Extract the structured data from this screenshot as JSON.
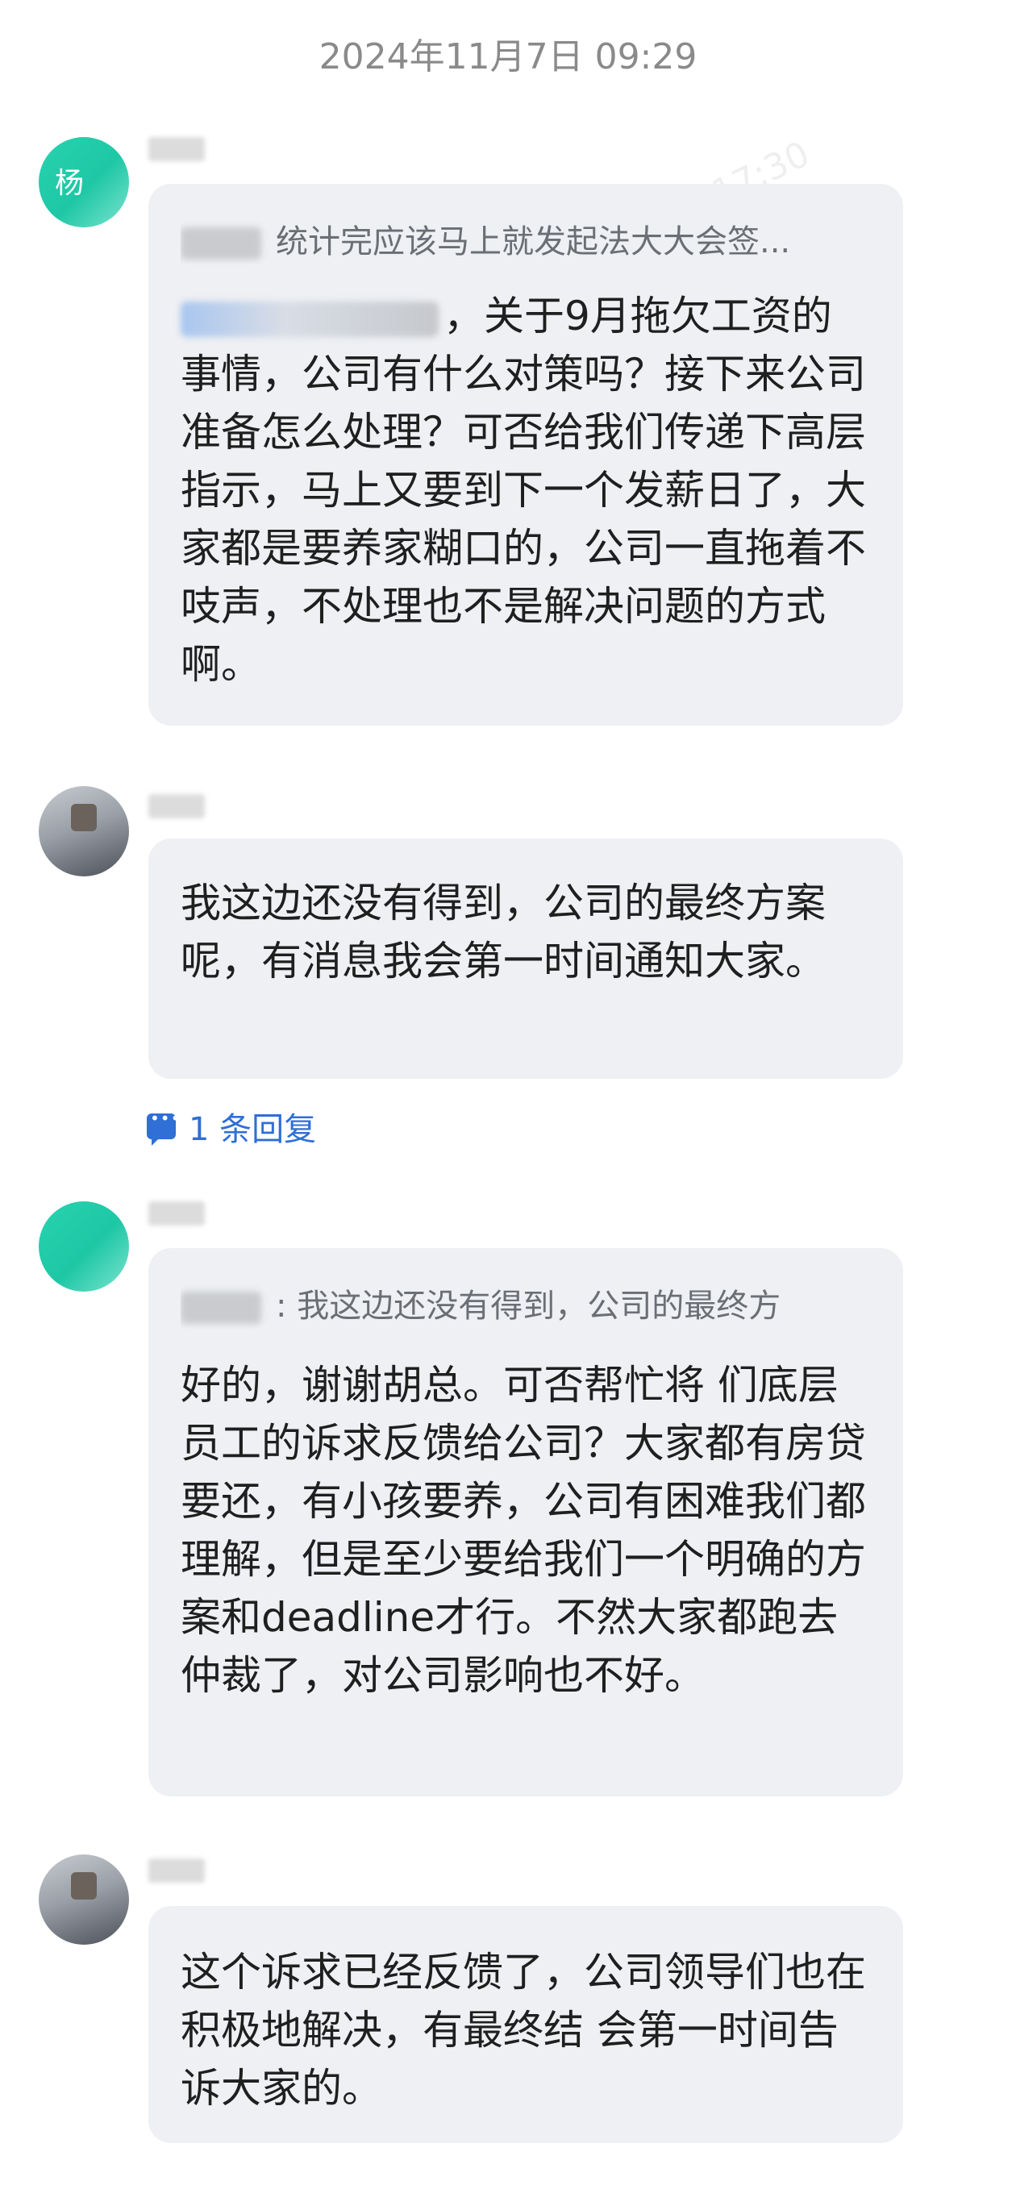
{
  "timestamp": "2024年11月7日 09:29",
  "messages": [
    {
      "avatar_initial": "杨",
      "quote": "统计完应该马上就发起法大大会签...",
      "text": "，关于9月拖欠工资的事情，公司有什么对策吗？接下来公司准备怎么处理？可否给我们传递下高层指示，马上又要到下一个发薪日了，大家都是要养家糊口的，公司一直拖着不吱声，不处理也不是解决问题的方式啊。"
    },
    {
      "text": "我这边还没有得到，公司的最终方案呢，有消息我会第一时间通知大家。",
      "reply_label": "1 条回复"
    },
    {
      "quote": ": 我这边还没有得到，公司的最终方",
      "text": "好的，谢谢胡总。可否帮忙将 们底层员工的诉求反馈给公司？大家都有房贷要还，有小孩要养，公司有困难我们都理解，但是至少要给我们一个明确的方案和deadline才行。不然大家都跑去仲裁了，对公司影响也不好。"
    },
    {
      "text": "这个诉求已经反馈了，公司领导们也在积极地解决，有最终结 会第一时间告诉大家的。"
    }
  ],
  "colors": {
    "bubble": "#eef0f3",
    "reply_link": "#2f6fd6",
    "teal_avatar": "#1ec7a5"
  }
}
